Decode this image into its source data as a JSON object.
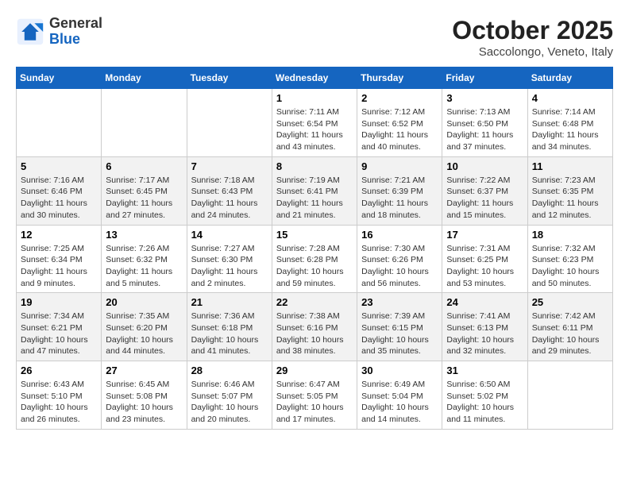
{
  "header": {
    "logo_general": "General",
    "logo_blue": "Blue",
    "month": "October 2025",
    "location": "Saccolongo, Veneto, Italy"
  },
  "days_of_week": [
    "Sunday",
    "Monday",
    "Tuesday",
    "Wednesday",
    "Thursday",
    "Friday",
    "Saturday"
  ],
  "weeks": [
    [
      {
        "day": "",
        "info": ""
      },
      {
        "day": "",
        "info": ""
      },
      {
        "day": "",
        "info": ""
      },
      {
        "day": "1",
        "info": "Sunrise: 7:11 AM\nSunset: 6:54 PM\nDaylight: 11 hours and 43 minutes."
      },
      {
        "day": "2",
        "info": "Sunrise: 7:12 AM\nSunset: 6:52 PM\nDaylight: 11 hours and 40 minutes."
      },
      {
        "day": "3",
        "info": "Sunrise: 7:13 AM\nSunset: 6:50 PM\nDaylight: 11 hours and 37 minutes."
      },
      {
        "day": "4",
        "info": "Sunrise: 7:14 AM\nSunset: 6:48 PM\nDaylight: 11 hours and 34 minutes."
      }
    ],
    [
      {
        "day": "5",
        "info": "Sunrise: 7:16 AM\nSunset: 6:46 PM\nDaylight: 11 hours and 30 minutes."
      },
      {
        "day": "6",
        "info": "Sunrise: 7:17 AM\nSunset: 6:45 PM\nDaylight: 11 hours and 27 minutes."
      },
      {
        "day": "7",
        "info": "Sunrise: 7:18 AM\nSunset: 6:43 PM\nDaylight: 11 hours and 24 minutes."
      },
      {
        "day": "8",
        "info": "Sunrise: 7:19 AM\nSunset: 6:41 PM\nDaylight: 11 hours and 21 minutes."
      },
      {
        "day": "9",
        "info": "Sunrise: 7:21 AM\nSunset: 6:39 PM\nDaylight: 11 hours and 18 minutes."
      },
      {
        "day": "10",
        "info": "Sunrise: 7:22 AM\nSunset: 6:37 PM\nDaylight: 11 hours and 15 minutes."
      },
      {
        "day": "11",
        "info": "Sunrise: 7:23 AM\nSunset: 6:35 PM\nDaylight: 11 hours and 12 minutes."
      }
    ],
    [
      {
        "day": "12",
        "info": "Sunrise: 7:25 AM\nSunset: 6:34 PM\nDaylight: 11 hours and 9 minutes."
      },
      {
        "day": "13",
        "info": "Sunrise: 7:26 AM\nSunset: 6:32 PM\nDaylight: 11 hours and 5 minutes."
      },
      {
        "day": "14",
        "info": "Sunrise: 7:27 AM\nSunset: 6:30 PM\nDaylight: 11 hours and 2 minutes."
      },
      {
        "day": "15",
        "info": "Sunrise: 7:28 AM\nSunset: 6:28 PM\nDaylight: 10 hours and 59 minutes."
      },
      {
        "day": "16",
        "info": "Sunrise: 7:30 AM\nSunset: 6:26 PM\nDaylight: 10 hours and 56 minutes."
      },
      {
        "day": "17",
        "info": "Sunrise: 7:31 AM\nSunset: 6:25 PM\nDaylight: 10 hours and 53 minutes."
      },
      {
        "day": "18",
        "info": "Sunrise: 7:32 AM\nSunset: 6:23 PM\nDaylight: 10 hours and 50 minutes."
      }
    ],
    [
      {
        "day": "19",
        "info": "Sunrise: 7:34 AM\nSunset: 6:21 PM\nDaylight: 10 hours and 47 minutes."
      },
      {
        "day": "20",
        "info": "Sunrise: 7:35 AM\nSunset: 6:20 PM\nDaylight: 10 hours and 44 minutes."
      },
      {
        "day": "21",
        "info": "Sunrise: 7:36 AM\nSunset: 6:18 PM\nDaylight: 10 hours and 41 minutes."
      },
      {
        "day": "22",
        "info": "Sunrise: 7:38 AM\nSunset: 6:16 PM\nDaylight: 10 hours and 38 minutes."
      },
      {
        "day": "23",
        "info": "Sunrise: 7:39 AM\nSunset: 6:15 PM\nDaylight: 10 hours and 35 minutes."
      },
      {
        "day": "24",
        "info": "Sunrise: 7:41 AM\nSunset: 6:13 PM\nDaylight: 10 hours and 32 minutes."
      },
      {
        "day": "25",
        "info": "Sunrise: 7:42 AM\nSunset: 6:11 PM\nDaylight: 10 hours and 29 minutes."
      }
    ],
    [
      {
        "day": "26",
        "info": "Sunrise: 6:43 AM\nSunset: 5:10 PM\nDaylight: 10 hours and 26 minutes."
      },
      {
        "day": "27",
        "info": "Sunrise: 6:45 AM\nSunset: 5:08 PM\nDaylight: 10 hours and 23 minutes."
      },
      {
        "day": "28",
        "info": "Sunrise: 6:46 AM\nSunset: 5:07 PM\nDaylight: 10 hours and 20 minutes."
      },
      {
        "day": "29",
        "info": "Sunrise: 6:47 AM\nSunset: 5:05 PM\nDaylight: 10 hours and 17 minutes."
      },
      {
        "day": "30",
        "info": "Sunrise: 6:49 AM\nSunset: 5:04 PM\nDaylight: 10 hours and 14 minutes."
      },
      {
        "day": "31",
        "info": "Sunrise: 6:50 AM\nSunset: 5:02 PM\nDaylight: 10 hours and 11 minutes."
      },
      {
        "day": "",
        "info": ""
      }
    ]
  ]
}
